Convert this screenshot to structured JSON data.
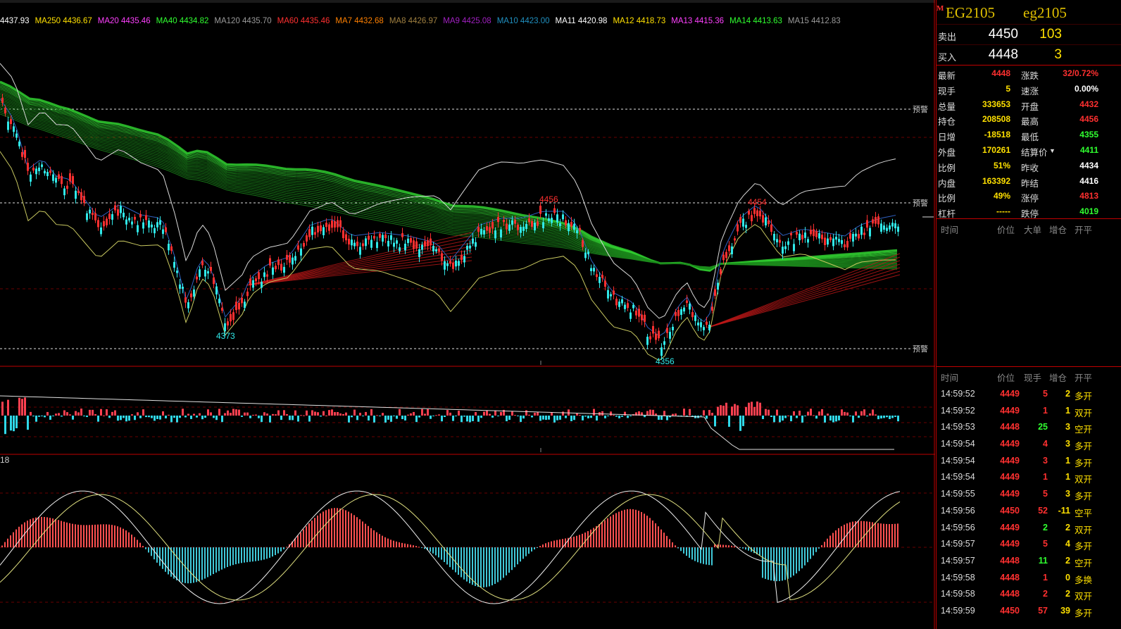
{
  "ma_legend": [
    {
      "text": "4437.93",
      "color": "#ffffff"
    },
    {
      "text": "MA250 4436.67",
      "color": "#ffe000"
    },
    {
      "text": "MA20 4435.46",
      "color": "#ff40ff"
    },
    {
      "text": "MA40 4434.82",
      "color": "#30ff30"
    },
    {
      "text": "MA120 4435.70",
      "color": "#9a9a9a"
    },
    {
      "text": "MA60 4435.46",
      "color": "#ff3030"
    },
    {
      "text": "MA7 4432.68",
      "color": "#ff8000"
    },
    {
      "text": "MA8 4426.97",
      "color": "#a08040"
    },
    {
      "text": "MA9 4425.08",
      "color": "#a020c0"
    },
    {
      "text": "MA10 4423.00",
      "color": "#2090c0"
    },
    {
      "text": "MA11 4420.98",
      "color": "#ffffff"
    },
    {
      "text": "MA12 4418.73",
      "color": "#ffe000"
    },
    {
      "text": "MA13 4415.36",
      "color": "#ff40ff"
    },
    {
      "text": "MA14 4413.63",
      "color": "#30ff30"
    },
    {
      "text": "MA15 4412.83",
      "color": "#9a9a9a"
    }
  ],
  "chart_labels": {
    "alert_label": "预警",
    "high_mark": "4456",
    "high_mark2": "4454",
    "low_mark1": "4373",
    "low_mark2": "4356",
    "indicator_value": "18"
  },
  "instrument": {
    "flag": "M",
    "code": "EG2105",
    "name": "eg2105"
  },
  "quote": {
    "ask_label": "卖出",
    "ask_price": "4450",
    "ask_vol": "103",
    "bid_label": "买入",
    "bid_price": "4448",
    "bid_vol": "3"
  },
  "stats": [
    {
      "l1": "最新",
      "v1": "4448",
      "c1": "#ff3030",
      "l2": "涨跌",
      "v2": "32/0.72%",
      "c2": "#ff3030"
    },
    {
      "l1": "现手",
      "v1": "5",
      "c1": "#ffe000",
      "l2": "速涨",
      "v2": "0.00%",
      "c2": "#ffffff"
    },
    {
      "l1": "总量",
      "v1": "333653",
      "c1": "#ffe000",
      "l2": "开盘",
      "v2": "4432",
      "c2": "#ff3030"
    },
    {
      "l1": "持仓",
      "v1": "208508",
      "c1": "#ffe000",
      "l2": "最高",
      "v2": "4456",
      "c2": "#ff3030"
    },
    {
      "l1": "日增",
      "v1": "-18518",
      "c1": "#ffe000",
      "l2": "最低",
      "v2": "4355",
      "c2": "#30ff30"
    },
    {
      "l1": "外盘",
      "v1": "170261",
      "c1": "#ffe000",
      "l2": "结算价",
      "v2": "4411",
      "c2": "#30ff30"
    },
    {
      "l1": "比例",
      "v1": "51%",
      "c1": "#ffe000",
      "l2": "昨收",
      "v2": "4434",
      "c2": "#ffffff"
    },
    {
      "l1": "内盘",
      "v1": "163392",
      "c1": "#ffe000",
      "l2": "昨结",
      "v2": "4416",
      "c2": "#ffffff"
    },
    {
      "l1": "比例",
      "v1": "49%",
      "c1": "#ffe000",
      "l2": "涨停",
      "v2": "4813",
      "c2": "#ff3030"
    },
    {
      "l1": "杠杆",
      "v1": "-----",
      "c1": "#ffe000",
      "l2": "跌停",
      "v2": "4019",
      "c2": "#30ff30"
    }
  ],
  "big_order_header": {
    "time": "时间",
    "price": "价位",
    "big": "大单",
    "oi": "增仓",
    "oc": "开平"
  },
  "tick_header": {
    "time": "时间",
    "price": "价位",
    "vol": "现手",
    "oi": "增仓",
    "oc": "开平"
  },
  "ticks": [
    {
      "time": "14:59:52",
      "price": "4449",
      "vol": "5",
      "vol_color": "#ff3030",
      "oi": "2",
      "type": "多开"
    },
    {
      "time": "14:59:52",
      "price": "4449",
      "vol": "1",
      "vol_color": "#ff3030",
      "oi": "1",
      "type": "双开"
    },
    {
      "time": "14:59:53",
      "price": "4448",
      "vol": "25",
      "vol_color": "#30ff30",
      "oi": "3",
      "type": "空开"
    },
    {
      "time": "14:59:54",
      "price": "4449",
      "vol": "4",
      "vol_color": "#ff3030",
      "oi": "3",
      "type": "多开"
    },
    {
      "time": "14:59:54",
      "price": "4449",
      "vol": "3",
      "vol_color": "#ff3030",
      "oi": "1",
      "type": "多开"
    },
    {
      "time": "14:59:54",
      "price": "4449",
      "vol": "1",
      "vol_color": "#ff3030",
      "oi": "1",
      "type": "双开"
    },
    {
      "time": "14:59:55",
      "price": "4449",
      "vol": "5",
      "vol_color": "#ff3030",
      "oi": "3",
      "type": "多开"
    },
    {
      "time": "14:59:56",
      "price": "4450",
      "vol": "52",
      "vol_color": "#ff3030",
      "oi": "-11",
      "type": "空平"
    },
    {
      "time": "14:59:56",
      "price": "4449",
      "vol": "2",
      "vol_color": "#30ff30",
      "oi": "2",
      "type": "双开"
    },
    {
      "time": "14:59:57",
      "price": "4449",
      "vol": "5",
      "vol_color": "#ff3030",
      "oi": "4",
      "type": "多开"
    },
    {
      "time": "14:59:57",
      "price": "4448",
      "vol": "11",
      "vol_color": "#30ff30",
      "oi": "2",
      "type": "空开"
    },
    {
      "time": "14:59:58",
      "price": "4448",
      "vol": "1",
      "vol_color": "#ff3030",
      "oi": "0",
      "type": "多换"
    },
    {
      "time": "14:59:58",
      "price": "4448",
      "vol": "2",
      "vol_color": "#ff3030",
      "oi": "2",
      "type": "双开"
    },
    {
      "time": "14:59:59",
      "price": "4450",
      "vol": "57",
      "vol_color": "#ff3030",
      "oi": "39",
      "type": "多开"
    }
  ],
  "colors": {
    "up": "#ff3030",
    "down": "#30e8e8",
    "ma_band": "#20c020",
    "panel_border": "#c00000",
    "alert_line": "#e0e0e0"
  }
}
